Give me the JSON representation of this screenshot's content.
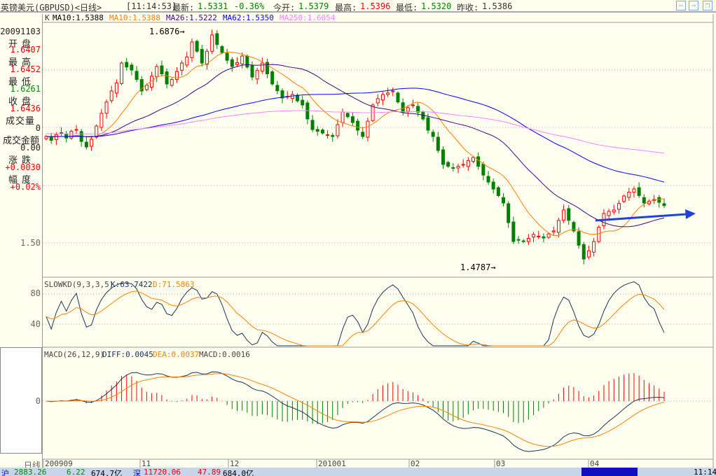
{
  "title": {
    "name": "英镑美元(GBPUSD)<日线>",
    "time": "[11:14:53]",
    "latest_label": "最新:",
    "latest": "1.5331",
    "change": "-0.36%",
    "open_label": "今开:",
    "open": "1.5379",
    "high_label": "最高:",
    "high": "1.5396",
    "low_label": "最低:",
    "low": "1.5320",
    "prev_label": "昨收:",
    "prev": "1.5386"
  },
  "nav": {
    "back": "⇦",
    "forward": "⇨",
    "restore": "❐"
  },
  "legend": {
    "k": "K",
    "ma10a": "MA10:1.5388",
    "ma10b": "MA10:1.5388",
    "ma26": "MA26:1.5222",
    "ma62": "MA62:1.5350",
    "ma250": "MA250:1.6054"
  },
  "info": {
    "date": "20091103",
    "open_l": "开盘",
    "open": "1.6407",
    "high_l": "最高",
    "high": "1.6452",
    "low_l": "最低",
    "low": "1.6261",
    "close_l": "收盘",
    "close": "1.6436",
    "vol_l": "成交量",
    "vol": "0",
    "amt_l": "成交金额",
    "amt": "0.00",
    "chg_l": "涨跌",
    "chg": "+0.0030",
    "pct_l": "幅度",
    "pct": "+0.02%"
  },
  "axis": {
    "price_tick": "1.50",
    "kd_ticks": [
      "80",
      "40"
    ],
    "macd_tick": "0",
    "period_label": "日线",
    "months": [
      "200909",
      "11",
      "12",
      "201001",
      "02",
      "03",
      "04"
    ]
  },
  "annotations": {
    "max": "1.6876→",
    "min": "1.4787→"
  },
  "kd_legend": {
    "name": "SLOWKD(9,3,3,5)",
    "k": "K:63.7422",
    "d": "D:71.5863"
  },
  "macd_legend": {
    "name": "MACD(26,12,9)",
    "diff": "DIFF:0.0045",
    "dea": "DEA:0.0037",
    "macd": "MACD:0.0016"
  },
  "statusbar": {
    "sh": "沪",
    "sh_idx": "2883.26",
    "sh_chg": "6.22",
    "sh_amt": "674.7亿",
    "sz": "深",
    "sz_idx": "11720.06",
    "sz_chg": "47.89",
    "sz_amt": "684.0亿",
    "time": "11:14"
  },
  "colors": {
    "up": "#ff0000",
    "down": "#008000",
    "ma10": "#ff7f00",
    "ma26": "#400080",
    "ma62": "#0000ff",
    "ma250": "#ff80ff",
    "kline": "#1a3355",
    "dline": "#ff8000",
    "arrow": "#2040e0"
  },
  "chart_data": {
    "type": "candlestick",
    "price_ylim": [
      1.46,
      1.7
    ],
    "close": [
      1.5944,
      1.591,
      1.596,
      1.5975,
      1.593,
      1.599,
      1.6006,
      1.59,
      1.5851,
      1.592,
      1.6037,
      1.615,
      1.625,
      1.6348,
      1.642,
      1.6596,
      1.656,
      1.6534,
      1.645,
      1.6348,
      1.64,
      1.648,
      1.6565,
      1.65,
      1.641,
      1.645,
      1.652,
      1.6596,
      1.665,
      1.6783,
      1.67,
      1.6596,
      1.67,
      1.6845,
      1.676,
      1.6689,
      1.662,
      1.6565,
      1.66,
      1.6658,
      1.656,
      1.6472,
      1.653,
      1.6596,
      1.65,
      1.641,
      1.635,
      1.6286,
      1.63,
      1.6317,
      1.626,
      1.6224,
      1.61,
      1.6006,
      1.599,
      1.5975,
      1.596,
      1.5944,
      1.605,
      1.6161,
      1.612,
      1.6068,
      1.6,
      1.5944,
      1.608,
      1.6224,
      1.628,
      1.6317,
      1.633,
      1.6348,
      1.625,
      1.6161,
      1.62,
      1.6224,
      1.616,
      1.6099,
      1.6,
      1.5944,
      1.582,
      1.5696,
      1.568,
      1.5665,
      1.568,
      1.5696,
      1.573,
      1.5758,
      1.568,
      1.5602,
      1.554,
      1.5478,
      1.542,
      1.5354,
      1.518,
      1.5012,
      1.503,
      1.5012,
      1.504,
      1.5075,
      1.506,
      1.5043,
      1.508,
      1.5106,
      1.52,
      1.5292,
      1.52,
      1.5106,
      1.498,
      1.4857,
      1.493,
      1.5012,
      1.514,
      1.5261,
      1.528,
      1.5292,
      1.535,
      1.5416,
      1.545,
      1.5478,
      1.542,
      1.5354,
      1.537,
      1.5385,
      1.536,
      1.5331
    ]
  }
}
